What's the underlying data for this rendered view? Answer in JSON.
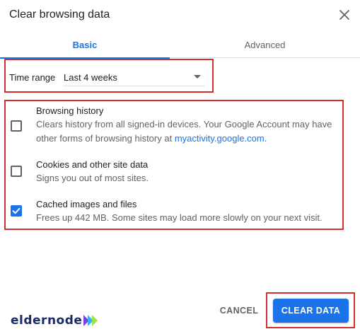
{
  "dialog": {
    "title": "Clear browsing data",
    "close_icon": "close-icon"
  },
  "tabs": [
    {
      "label": "Basic",
      "active": true
    },
    {
      "label": "Advanced",
      "active": false
    }
  ],
  "time_range": {
    "label": "Time range",
    "value": "Last 4 weeks"
  },
  "items": [
    {
      "title": "Browsing history",
      "desc_before": "Clears history from all signed-in devices. Your Google Account may have other forms of browsing history at ",
      "link": "myactivity.google.com",
      "desc_after": ".",
      "checked": false
    },
    {
      "title": "Cookies and other site data",
      "desc": "Signs you out of most sites.",
      "checked": false
    },
    {
      "title": "Cached images and files",
      "desc": "Frees up 442 MB. Some sites may load more slowly on your next visit.",
      "checked": true
    }
  ],
  "footer": {
    "brand_name": "eldernode",
    "cancel_label": "CANCEL",
    "clear_label": "CLEAR DATA"
  },
  "colors": {
    "accent": "#1a73e8",
    "highlight": "#d32f2f",
    "brand": "#1b2a6b"
  }
}
